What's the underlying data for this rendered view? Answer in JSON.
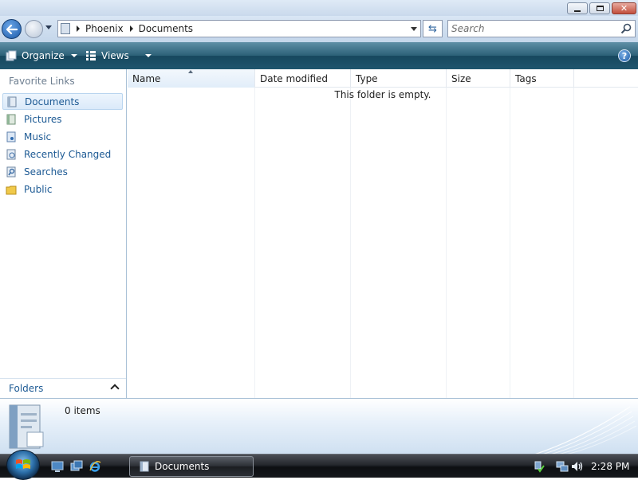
{
  "window": {
    "title": ""
  },
  "address": {
    "breadcrumb": [
      "Phoenix",
      "Documents"
    ],
    "search_placeholder": "Search"
  },
  "toolbar": {
    "organize_label": "Organize",
    "views_label": "Views",
    "help_label": "?"
  },
  "nav": {
    "favorites_heading": "Favorite Links",
    "items": [
      {
        "label": "Documents",
        "icon": "documents-icon",
        "selected": true
      },
      {
        "label": "Pictures",
        "icon": "pictures-icon"
      },
      {
        "label": "Music",
        "icon": "music-icon"
      },
      {
        "label": "Recently Changed",
        "icon": "recently-changed-icon"
      },
      {
        "label": "Searches",
        "icon": "searches-icon"
      },
      {
        "label": "Public",
        "icon": "public-folder-icon"
      }
    ],
    "folders_label": "Folders"
  },
  "filelist": {
    "columns": [
      "Name",
      "Date modified",
      "Type",
      "Size",
      "Tags"
    ],
    "sorted_column": "Name",
    "empty_message": "This folder is empty."
  },
  "details": {
    "item_count": "0 items"
  },
  "taskbar": {
    "active_task": "Documents",
    "clock": "2:28 PM"
  },
  "colors": {
    "command_bar": "#2b6077",
    "nav_link": "#1d5a94",
    "taskbar": "#15181c"
  }
}
